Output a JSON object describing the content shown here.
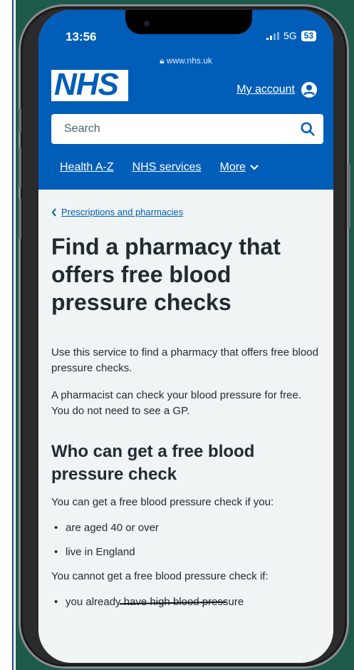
{
  "status_bar": {
    "time": "13:56",
    "network": "5G",
    "battery": "53"
  },
  "browser": {
    "url": "www.nhs.uk"
  },
  "header": {
    "logo": "NHS",
    "account_label": "My account",
    "search_placeholder": "Search",
    "nav": {
      "item1": "Health A-Z",
      "item2": "NHS services",
      "item3": "More"
    }
  },
  "main": {
    "breadcrumb": "Prescriptions and pharmacies",
    "title": "Find a pharmacy that offers free blood pressure checks",
    "intro1": "Use this service to find a pharmacy that offers free blood pressure checks.",
    "intro2": "A pharmacist can check your blood pressure for free. You do not need to see a GP.",
    "heading2": "Who can get a free blood pressure check",
    "can_get_intro": "You can get a free blood pressure check if you:",
    "eligibility": [
      "are aged 40 or over",
      "live in England"
    ],
    "cannot_get_intro": "You cannot get a free blood pressure check if:",
    "cannot_item": "you already have high blood pressure"
  },
  "colors": {
    "nhs_blue": "#005eb8",
    "page_bg": "#f0f4f5",
    "text": "#212b32",
    "backdrop": "#1d5a4c"
  }
}
